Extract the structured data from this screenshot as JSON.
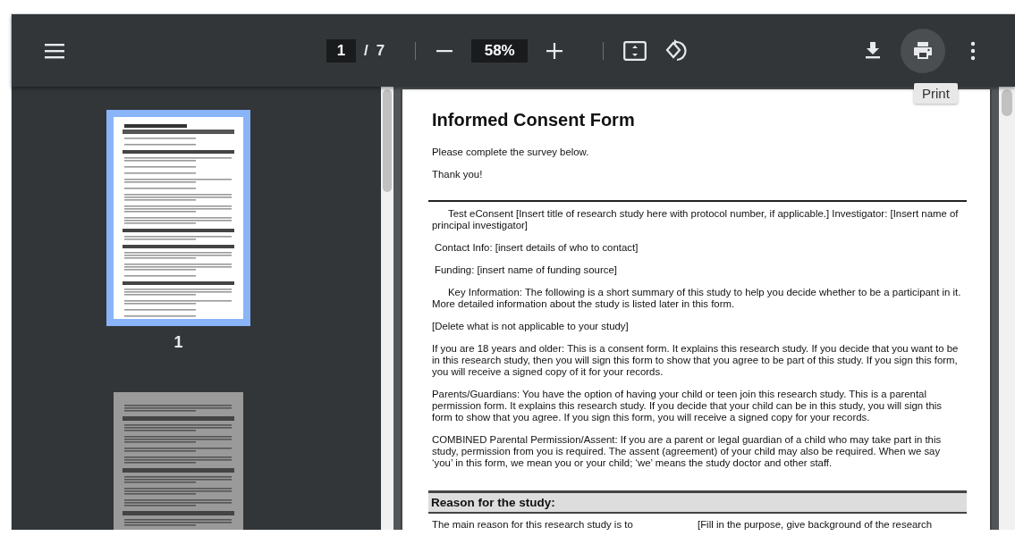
{
  "toolbar": {
    "page_input": "1",
    "page_separator": "/",
    "page_count": "7",
    "zoom": "58%",
    "actions": [
      {
        "kind": "download",
        "hovered": false
      },
      {
        "kind": "print",
        "hovered": true
      },
      {
        "kind": "more",
        "hovered": false
      }
    ],
    "tooltip": "Print"
  },
  "sidebar": {
    "thumbnails": [
      {
        "label": "1",
        "selected": true
      },
      {
        "selected": false
      }
    ]
  },
  "document": {
    "title": "Informed Consent Form",
    "blocks": [
      {
        "kind": "paragraph",
        "text": "Please complete the survey below."
      },
      {
        "kind": "paragraph",
        "text": "Thank you!"
      },
      {
        "kind": "rule"
      },
      {
        "kind": "indented",
        "text": "Test eConsent [Insert title of research study here with protocol number, if applicable.] Investigator: [Insert name of principal investigator]"
      },
      {
        "kind": "nudged",
        "text": "Contact Info: [insert details of who to contact]"
      },
      {
        "kind": "nudged",
        "text": "Funding: [insert name of funding source]"
      },
      {
        "kind": "indented",
        "text": "Key Information:  The following is a short summary of this study to help you decide whether to be a participant in it. More detailed information about the study is listed later in this form."
      },
      {
        "kind": "paragraph",
        "text": "[Delete what is not applicable to your study]"
      },
      {
        "kind": "paragraph",
        "text": "If you are 18 years and older: This is a consent form. It explains this research study. If you decide that you want to be in this research study, then you will sign this form to show that you agree to be part of this study. If you sign this form, you will receive a signed copy of it for your records."
      },
      {
        "kind": "paragraph",
        "text": "Parents/Guardians: You have the option of having your child or teen join this research study. This is a parental permission form. It explains this research study. If you decide that your child can be in this study, you will sign this form to show that you agree. If you sign this form, you will receive a signed copy for your records."
      },
      {
        "kind": "paragraph",
        "text": "COMBINED Parental Permission/Assent: If you are a parent or legal guardian of a child who may take part in this study, permission from you is required. The assent (agreement) of your child may also be required. When we say ‘you’ in this form, we mean you or your child; ‘we’ means the study doctor and other staff."
      },
      {
        "kind": "heading",
        "text": "Reason for the study:"
      },
      {
        "kind": "columns",
        "left": "The main reason for this research study is to",
        "right": "[Fill in the purpose, give background of the research"
      }
    ]
  }
}
